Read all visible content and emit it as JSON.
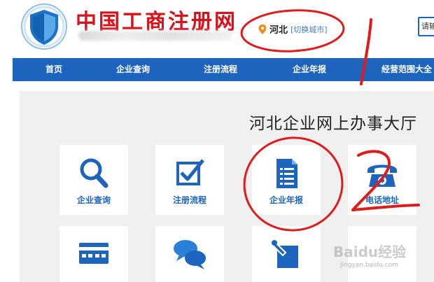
{
  "header": {
    "logo_text": "中国工商注册网",
    "location": {
      "city": "河北",
      "switch_label": "[切换城市]"
    },
    "search_placeholder": "请输"
  },
  "nav": {
    "items": [
      {
        "label": "首页"
      },
      {
        "label": "企业查询"
      },
      {
        "label": "注册流程"
      },
      {
        "label": "企业年报"
      },
      {
        "label": "经营范围大全"
      }
    ]
  },
  "main": {
    "title": "河北企业网上办事大厅",
    "tiles": [
      {
        "label": "企业查询",
        "icon": "magnifier-icon"
      },
      {
        "label": "注册流程",
        "icon": "checkbox-icon"
      },
      {
        "label": "企业年报",
        "icon": "document-icon"
      },
      {
        "label": "电话地址",
        "icon": "telephone-icon"
      },
      {
        "label": "",
        "icon": "card-icon"
      },
      {
        "label": "",
        "icon": "chat-bubbles-icon"
      },
      {
        "label": "",
        "icon": "edit-icon"
      }
    ]
  },
  "annotations": {
    "mark_1": "1",
    "mark_2": "2",
    "color": "#e01b1b"
  },
  "watermark": {
    "brand": "Baidu经验",
    "url": "jingyan.baidu.com"
  },
  "colors": {
    "brand_blue": "#1d64be",
    "logo_red": "#d8121b"
  }
}
